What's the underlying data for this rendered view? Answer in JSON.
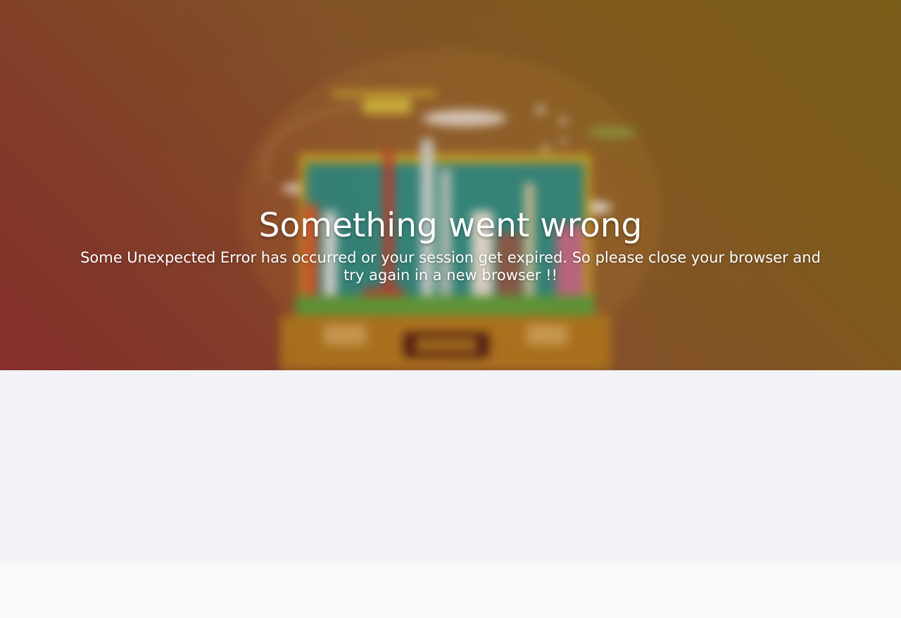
{
  "hero": {
    "title": "Something went wrong",
    "message": "Some Unexpected Error has occurred or your session get expired. So please close your browser and try again in a new browser !!",
    "illustration": "travel-suitcase-landmarks-icon"
  },
  "colors": {
    "hero_gradient_start": "#8c2e30",
    "hero_gradient_end": "#80641a",
    "content_background": "#f2f3f7",
    "footer_background": "#f9f9f9",
    "text": "#ffffff"
  }
}
